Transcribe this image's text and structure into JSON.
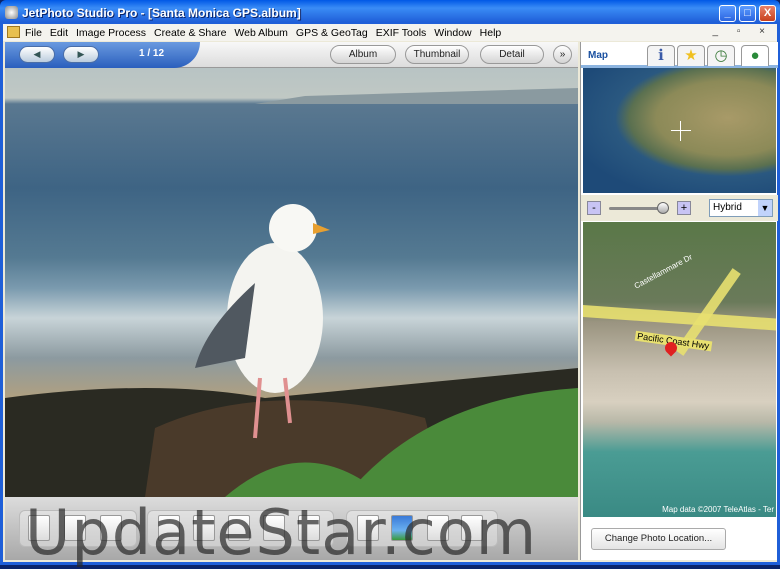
{
  "window": {
    "title": "JetPhoto Studio Pro - [Santa Monica GPS.album]",
    "minimize": "_",
    "maximize": "□",
    "close": "X"
  },
  "menu": [
    "File",
    "Edit",
    "Image Process",
    "Create & Share",
    "Web Album",
    "GPS & GeoTag",
    "EXIF Tools",
    "Window",
    "Help"
  ],
  "mdi_controls": "_ ▫ ×",
  "nav": {
    "prev": "◀",
    "next": "▶",
    "counter": "1 / 12",
    "views": [
      "Album",
      "Thumbnail",
      "Detail"
    ],
    "more": "»"
  },
  "side": {
    "tab_label": "Map",
    "tabs": [
      {
        "icon": "info-icon",
        "glyph": "ℹ"
      },
      {
        "icon": "star-icon",
        "glyph": "★"
      },
      {
        "icon": "clock-icon",
        "glyph": "◷"
      },
      {
        "icon": "globe-icon",
        "glyph": "●"
      }
    ],
    "zoom_out": "-",
    "zoom_in": "+",
    "map_type": "Hybrid",
    "zoom_level": 0.85,
    "street_labels": [
      "Castellammare Dr",
      "Pacific Coast Hwy"
    ],
    "map_credit": "Map data ©2007 TeleAtlas - Ter",
    "change_location": "Change Photo Location..."
  },
  "watermark": "UpdateStar.com"
}
